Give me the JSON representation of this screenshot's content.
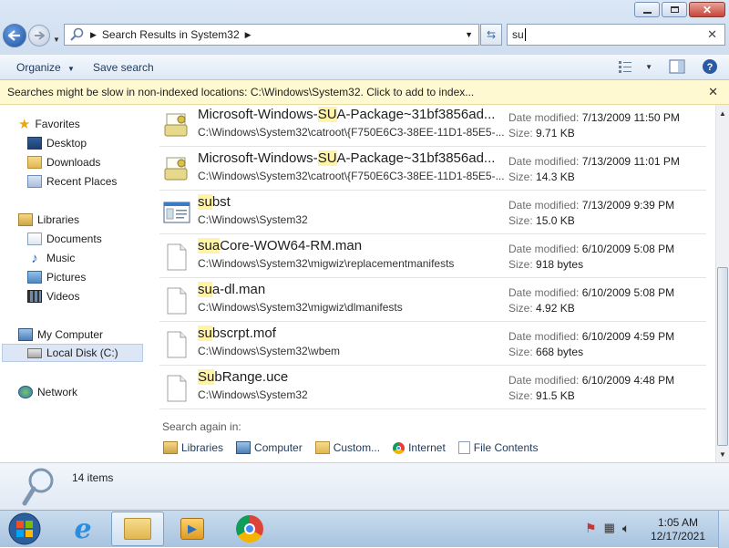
{
  "window": {
    "minimize": "minimize",
    "maximize": "maximize",
    "close": "close"
  },
  "address": {
    "text": "Search Results in System32"
  },
  "search": {
    "value": "su"
  },
  "toolbar": {
    "organize": "Organize",
    "save_search": "Save search"
  },
  "infobar": {
    "text": "Searches might be slow in non-indexed locations: C:\\Windows\\System32. Click to add to index..."
  },
  "nav": {
    "favorites": "Favorites",
    "desktop": "Desktop",
    "downloads": "Downloads",
    "recent_places": "Recent Places",
    "libraries": "Libraries",
    "documents": "Documents",
    "music": "Music",
    "pictures": "Pictures",
    "videos": "Videos",
    "my_computer": "My Computer",
    "local_disk": "Local Disk (C:)",
    "network": "Network"
  },
  "results": [
    {
      "pre": "Microsoft-Windows-",
      "hl": "SU",
      "post": "A-Package~31bf3856ad...",
      "path": "C:\\Windows\\System32\\catroot\\{F750E6C3-38EE-11D1-85E5-...",
      "mod_label": "Date modified:",
      "mod": "7/13/2009 11:50 PM",
      "size_label": "Size:",
      "size": "9.71 KB",
      "icon": "catalog-icon"
    },
    {
      "pre": "Microsoft-Windows-",
      "hl": "SU",
      "post": "A-Package~31bf3856ad...",
      "path": "C:\\Windows\\System32\\catroot\\{F750E6C3-38EE-11D1-85E5-...",
      "mod_label": "Date modified:",
      "mod": "7/13/2009 11:01 PM",
      "size_label": "Size:",
      "size": "14.3 KB",
      "icon": "catalog-icon"
    },
    {
      "pre": "",
      "hl": "su",
      "post": "bst",
      "path": "C:\\Windows\\System32",
      "mod_label": "Date modified:",
      "mod": "7/13/2009 9:39 PM",
      "size_label": "Size:",
      "size": "15.0 KB",
      "icon": "application-icon"
    },
    {
      "pre": "",
      "hl": "sua",
      "post": "Core-WOW64-RM.man",
      "path": "C:\\Windows\\System32\\migwiz\\replacementmanifests",
      "mod_label": "Date modified:",
      "mod": "6/10/2009 5:08 PM",
      "size_label": "Size:",
      "size": "918 bytes",
      "icon": "file-icon"
    },
    {
      "pre": "",
      "hl": "su",
      "post": "a-dl.man",
      "path": "C:\\Windows\\System32\\migwiz\\dlmanifests",
      "mod_label": "Date modified:",
      "mod": "6/10/2009 5:08 PM",
      "size_label": "Size:",
      "size": "4.92 KB",
      "icon": "file-icon"
    },
    {
      "pre": "",
      "hl": "su",
      "post": "bscrpt.mof",
      "path": "C:\\Windows\\System32\\wbem",
      "mod_label": "Date modified:",
      "mod": "6/10/2009 4:59 PM",
      "size_label": "Size:",
      "size": "668 bytes",
      "icon": "file-icon"
    },
    {
      "pre": "",
      "hl": "Su",
      "post": "bRange.uce",
      "path": "C:\\Windows\\System32",
      "mod_label": "Date modified:",
      "mod": "6/10/2009 4:48 PM",
      "size_label": "Size:",
      "size": "91.5 KB",
      "icon": "file-icon"
    }
  ],
  "search_again": {
    "label": "Search again in:",
    "libraries": "Libraries",
    "computer": "Computer",
    "custom": "Custom...",
    "internet": "Internet",
    "file_contents": "File Contents"
  },
  "details": {
    "count": "14 items"
  },
  "taskbar": {
    "time": "1:05 AM",
    "date": "12/17/2021"
  },
  "colors": {
    "highlight": "#fff3a8",
    "infobar": "#fff9d1",
    "accent": "#1e395b"
  }
}
